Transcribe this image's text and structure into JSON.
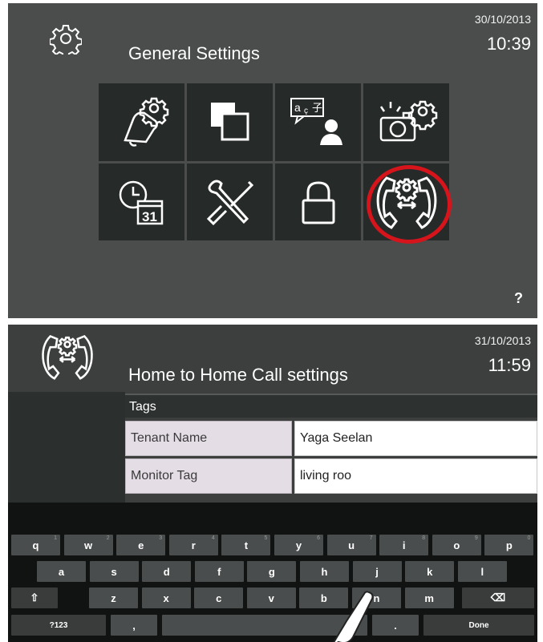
{
  "top_screen": {
    "title": "General Settings",
    "date": "30/10/2013",
    "time": "10:39",
    "help_label": "?",
    "tiles": [
      {
        "icon": "bell-gear-icon"
      },
      {
        "icon": "overlapping-squares-icon"
      },
      {
        "icon": "language-person-icon",
        "text": "a ç 子"
      },
      {
        "icon": "camera-gear-icon"
      },
      {
        "icon": "clock-calendar-icon",
        "text": "31"
      },
      {
        "icon": "tools-icon"
      },
      {
        "icon": "padlock-icon"
      },
      {
        "icon": "home-to-home-call-icon",
        "highlighted": true
      }
    ],
    "highlight_color": "#d6141c"
  },
  "bottom_screen": {
    "title": "Home to Home Call settings",
    "date": "31/10/2013",
    "time": "11:59",
    "section_header": "Tags",
    "fields": [
      {
        "label": "Tenant Name",
        "value": "Yaga Seelan"
      },
      {
        "label": "Monitor Tag",
        "value": "living roo"
      }
    ]
  },
  "keyboard": {
    "row1": [
      "q",
      "w",
      "e",
      "r",
      "t",
      "y",
      "u",
      "i",
      "o",
      "p"
    ],
    "row1_hints": [
      "1",
      "2",
      "3",
      "4",
      "5",
      "6",
      "7",
      "8",
      "9",
      "0"
    ],
    "row2": [
      "a",
      "s",
      "d",
      "f",
      "g",
      "h",
      "j",
      "k",
      "l"
    ],
    "row3": [
      "z",
      "x",
      "c",
      "v",
      "b",
      "n",
      "m"
    ],
    "shift_label": "⇧",
    "delete_label": "⌫",
    "mode_label": "?123",
    "comma_label": ",",
    "period_label": ".",
    "done_label": "Done"
  }
}
